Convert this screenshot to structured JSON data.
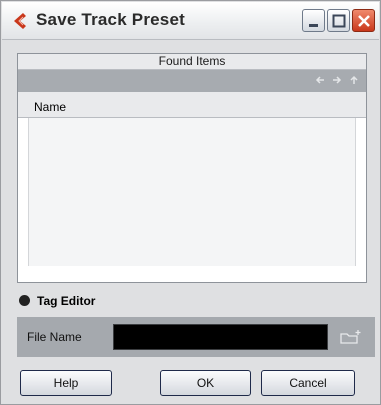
{
  "window": {
    "title": "Save Track Preset"
  },
  "title_buttons": {
    "minimize": "minimize-icon",
    "maximize": "maximize-icon",
    "close": "close-icon"
  },
  "browser": {
    "header": "Found Items",
    "nav": [
      "back-arrow-icon",
      "forward-arrow-icon",
      "up-arrow-icon"
    ],
    "column_header": "Name",
    "items": []
  },
  "tag_editor": {
    "label": "Tag Editor"
  },
  "file": {
    "label": "File Name",
    "value": "",
    "browse_icon": "new-folder-icon"
  },
  "buttons": {
    "help": "Help",
    "ok": "OK",
    "cancel": "Cancel"
  },
  "colors": {
    "accent": "#c9371b",
    "panel_bar": "#a7abb0",
    "file_input": "#000000"
  }
}
